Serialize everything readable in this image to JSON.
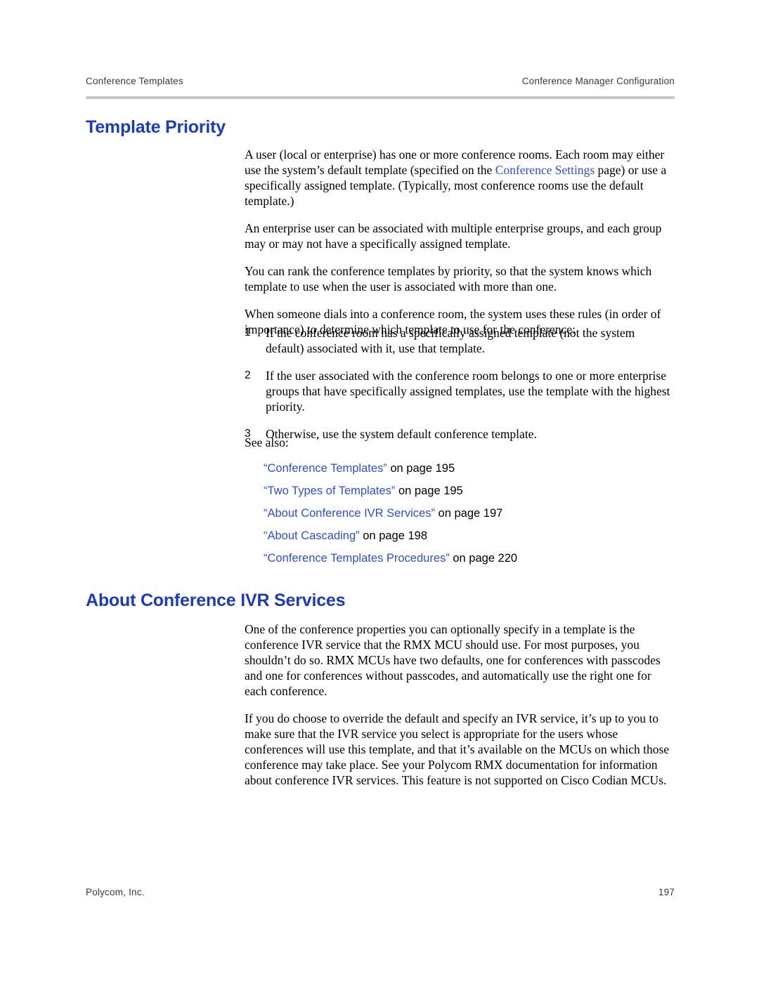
{
  "header": {
    "left": "Conference Templates",
    "right": "Conference Manager Configuration"
  },
  "sections": {
    "template_priority": {
      "title": "Template Priority",
      "paragraphs": {
        "p1_a": "A user (local or enterprise) has one or more conference rooms. Each room may either use the system’s default template (specified on the ",
        "p1_link": "Conference Settings",
        "p1_b": " page) or use a specifically assigned template. (Typically, most conference rooms use the default template.)",
        "p2": "An enterprise user can be associated with multiple enterprise groups, and each group may or may not have a specifically assigned template.",
        "p3": "You can rank the conference templates by priority, so that the system knows which template to use when the user is associated with more than one.",
        "p4": "When someone dials into a conference room, the system uses these rules (in order of importance) to determine which template to use for the conference:"
      },
      "steps": [
        {
          "num": "1",
          "text": "If the conference room has a specifically assigned template (not the system default) associated with it, use that template."
        },
        {
          "num": "2",
          "text": "If the user associated with the conference room belongs to one or more enterprise groups that have specifically assigned templates, use the template with the highest priority."
        },
        {
          "num": "3",
          "text": "Otherwise, use the system default conference template."
        }
      ],
      "see_also_label": "See also:",
      "see_also": [
        {
          "link": "“Conference Templates”",
          "rest": " on page 195"
        },
        {
          "link": "“Two Types of Templates”",
          "rest": " on page 195"
        },
        {
          "link": "“About Conference IVR Services”",
          "rest": " on page 197"
        },
        {
          "link": "“About Cascading”",
          "rest": " on page 198"
        },
        {
          "link": "“Conference Templates Procedures”",
          "rest": " on page 220"
        }
      ]
    },
    "about_ivr": {
      "title": "About Conference IVR Services",
      "paragraphs": {
        "p1": "One of the conference properties you can optionally specify in a template is the conference IVR service that the RMX MCU should use. For most purposes, you shouldn’t do so. RMX MCUs have two defaults, one for conferences with passcodes and one for conferences without passcodes, and automatically use the right one for each conference.",
        "p2": "If you do choose to override the default and specify an IVR service, it’s up to you to make sure that the IVR service you select is appropriate for the users whose conferences will use this template, and that it’s available on the MCUs on which those conference may take place. See your Polycom RMX documentation for information about conference IVR services. This feature is not supported on Cisco Codian MCUs."
      }
    }
  },
  "footer": {
    "left": "Polycom, Inc.",
    "right": "197"
  }
}
